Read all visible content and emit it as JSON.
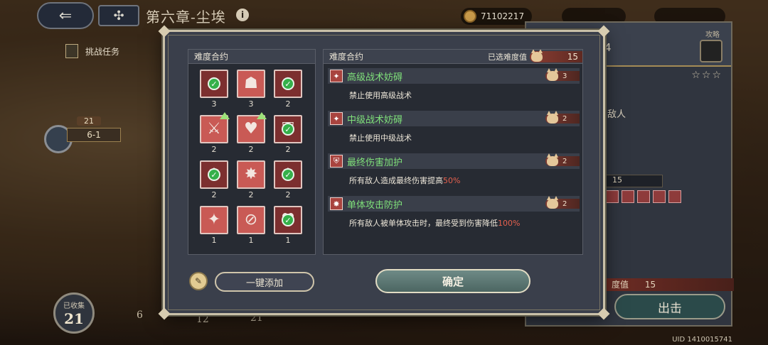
{
  "hud": {
    "chapter_title": "第六章-尘埃",
    "currency": "71102217"
  },
  "map": {
    "task_label": "挑战任务",
    "stage_name": "6-1",
    "stage_level": "21",
    "collected_label": "已收集",
    "collected_count": "21",
    "track_numbers": [
      "6",
      "12",
      "21"
    ]
  },
  "side": {
    "title": "4",
    "strategy_label": "攻略",
    "enemy_text": "敌人",
    "difficulty_count": "15",
    "difficulty_label": "度值",
    "difficulty_value": "15",
    "start_label": "出击",
    "uid": "UID 1410015741"
  },
  "modal": {
    "left_title": "难度合约",
    "right_title": "难度合约",
    "selected_label": "已选难度值",
    "selected_value": "15",
    "tiles": [
      {
        "glyph": "✦",
        "count": "3",
        "checked": true,
        "upgrade": false,
        "shade": "dark"
      },
      {
        "glyph": "☗",
        "count": "3",
        "checked": false,
        "upgrade": false,
        "shade": "light"
      },
      {
        "glyph": "✦",
        "count": "2",
        "checked": true,
        "upgrade": false,
        "shade": "dark"
      },
      {
        "glyph": "⚔",
        "count": "2",
        "checked": false,
        "upgrade": true,
        "shade": "light"
      },
      {
        "glyph": "♥",
        "count": "2",
        "checked": false,
        "upgrade": true,
        "shade": "light"
      },
      {
        "glyph": "⛨",
        "count": "2",
        "checked": true,
        "upgrade": false,
        "shade": "dark"
      },
      {
        "glyph": "✸",
        "count": "2",
        "checked": true,
        "upgrade": false,
        "shade": "dark"
      },
      {
        "glyph": "✸",
        "count": "2",
        "checked": false,
        "upgrade": false,
        "shade": "light"
      },
      {
        "glyph": "✸",
        "count": "2",
        "checked": true,
        "upgrade": false,
        "shade": "dark"
      },
      {
        "glyph": "✦",
        "count": "1",
        "checked": false,
        "upgrade": false,
        "shade": "light"
      },
      {
        "glyph": "⊘",
        "count": "1",
        "checked": false,
        "upgrade": false,
        "shade": "light"
      },
      {
        "glyph": "♥",
        "count": "1",
        "checked": true,
        "upgrade": false,
        "shade": "dark"
      }
    ],
    "rules": [
      {
        "title": "高级战术妨碍",
        "cost": "3",
        "desc": "禁止使用高级战术",
        "highlight": ""
      },
      {
        "title": "中级战术妨碍",
        "cost": "2",
        "desc": "禁止使用中级战术",
        "highlight": ""
      },
      {
        "title": "最终伤害加护",
        "cost": "2",
        "desc": "所有敌人造成最终伤害提高",
        "highlight": "50%"
      },
      {
        "title": "单体攻击防护",
        "cost": "2",
        "desc": "所有敌人被单体攻击时，最终受到伤害降低",
        "highlight": "100%"
      }
    ],
    "auto_add_label": "一键添加",
    "confirm_label": "确定"
  }
}
